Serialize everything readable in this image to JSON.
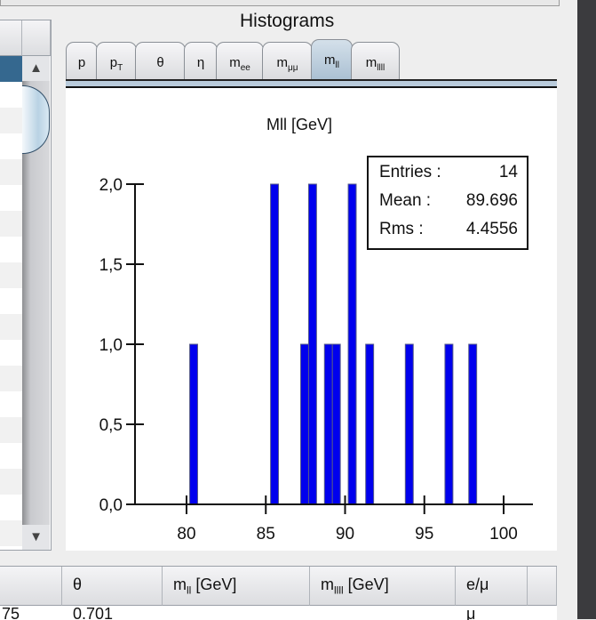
{
  "histograms_title": "Histograms",
  "tabs": [
    {
      "label": "p",
      "sub": ""
    },
    {
      "label": "p",
      "sub": "T"
    },
    {
      "label": "θ",
      "sub": ""
    },
    {
      "label": "η",
      "sub": ""
    },
    {
      "label": "m",
      "sub": "ee"
    },
    {
      "label": "m",
      "sub": "μμ"
    },
    {
      "label": "m",
      "sub": "ll",
      "selected": true
    },
    {
      "label": "m",
      "sub": "llll"
    }
  ],
  "stats": {
    "entries_label": "Entries :",
    "entries": "14",
    "mean_label": "Mean :",
    "mean": "89.696",
    "rms_label": "Rms :",
    "rms": "4.4556"
  },
  "chart_data": {
    "type": "bar",
    "title": "Mll [GeV]",
    "bin_width": 0.5,
    "bin_lows": [
      80.2,
      85.3,
      87.2,
      87.7,
      88.7,
      89.2,
      90.2,
      91.3,
      93.8,
      96.3,
      97.8
    ],
    "values": [
      1,
      2,
      1,
      2,
      1,
      1,
      2,
      1,
      1,
      1,
      1
    ],
    "xlim": [
      76.6,
      101
    ],
    "ylim": [
      0,
      2.0
    ],
    "xticks": [
      "80",
      "85",
      "90",
      "95",
      "100"
    ],
    "yticks": [
      "0,0",
      "0,5",
      "1,0",
      "1,5",
      "2,0"
    ],
    "bar_color": "#0000ee",
    "grid": false
  },
  "bottom_table": {
    "headers": [
      {
        "label": "",
        "sub": ""
      },
      {
        "label": "θ",
        "sub": ""
      },
      {
        "label": "m",
        "sub": "ll",
        "suffix": " [GeV]"
      },
      {
        "label": "m",
        "sub": "llll",
        "suffix": " [GeV]"
      },
      {
        "label": "e/μ",
        "sub": ""
      }
    ],
    "row": [
      "75",
      "0.701",
      "",
      "",
      "μ"
    ]
  },
  "colors": {
    "selected_row": "#35688f",
    "tab_selected": "#a9bfd2"
  }
}
